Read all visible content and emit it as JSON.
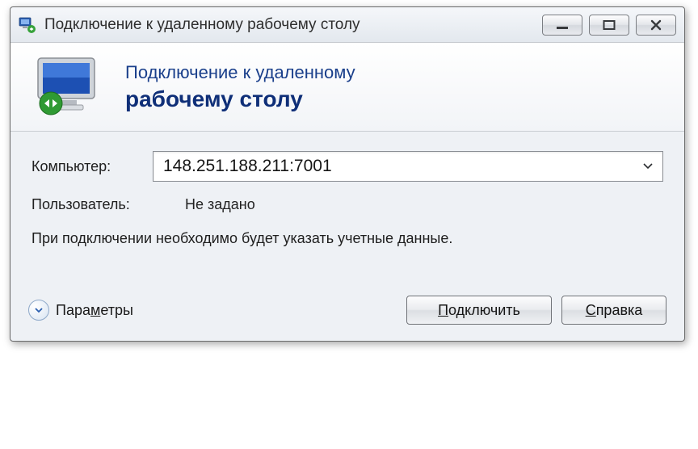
{
  "window": {
    "title": "Подключение к удаленному рабочему столу"
  },
  "header": {
    "line1": "Подключение к удаленному",
    "line2": "рабочему столу"
  },
  "form": {
    "computer_label": "Компьютер:",
    "computer_value": "148.251.188.211:7001",
    "user_label": "Пользователь:",
    "user_value": "Не задано",
    "note": "При подключении необходимо будет указать учетные данные."
  },
  "footer": {
    "options_prefix": "Пара",
    "options_hotkey": "м",
    "options_suffix": "етры",
    "connect_prefix": "",
    "connect_hotkey": "П",
    "connect_suffix": "одключить",
    "help_prefix": "",
    "help_hotkey": "С",
    "help_suffix": "правка"
  }
}
